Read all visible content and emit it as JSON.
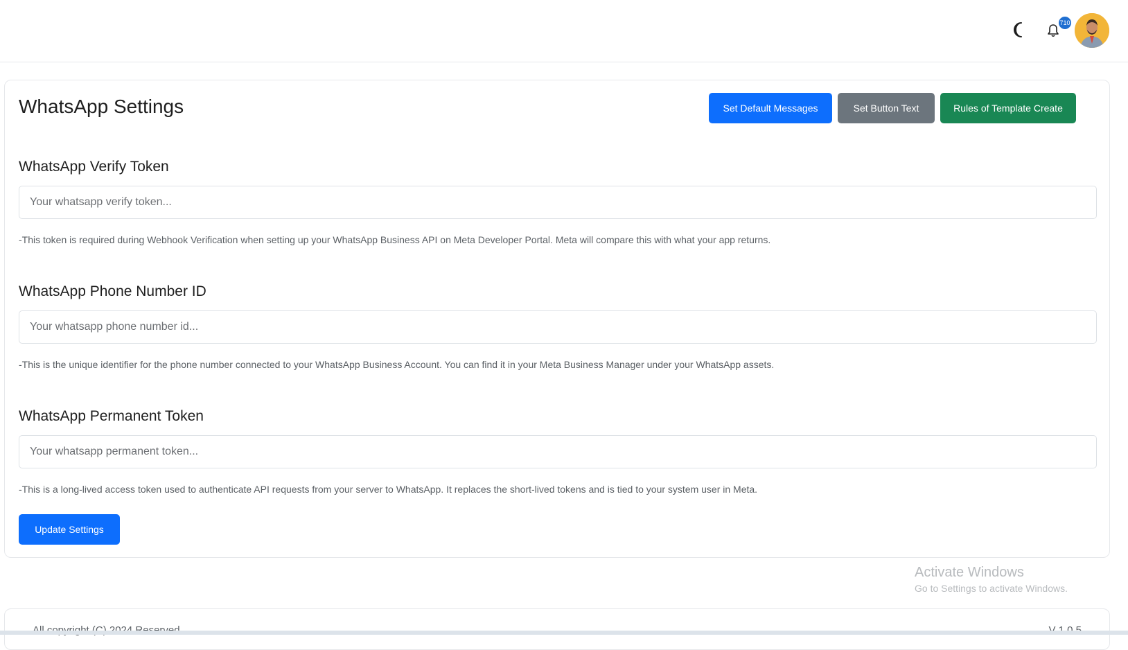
{
  "topbar": {
    "notifications_count": "710",
    "icons": {
      "theme": "moon-icon",
      "notifications": "bell-icon"
    },
    "avatar_bg": "#f2b538",
    "badge_color": "#1f6fd1"
  },
  "settings": {
    "title": "WhatsApp Settings",
    "buttons": {
      "default_messages": "Set Default Messages",
      "button_text": "Set Button Text",
      "template_rules": "Rules of Template Create"
    },
    "fields": [
      {
        "label": "WhatsApp Verify Token",
        "value": "",
        "placeholder": "Your whatsapp verify token...",
        "help": "-This token is required during Webhook Verification when setting up your WhatsApp Business API on Meta Developer Portal. Meta will compare this with what your app returns."
      },
      {
        "label": "WhatsApp Phone Number ID",
        "value": "",
        "placeholder": "Your whatsapp phone number id...",
        "help": "-This is the unique identifier for the phone number connected to your WhatsApp Business Account. You can find it in your Meta Business Manager under your WhatsApp assets."
      },
      {
        "label": "WhatsApp Permanent Token",
        "value": "",
        "placeholder": "Your whatsapp permanent token...",
        "help": "-This is a long-lived access token used to authenticate API requests from your server to WhatsApp. It replaces the short-lived tokens and is tied to your system user in Meta."
      }
    ],
    "submit_label": "Update Settings",
    "colors": {
      "primary": "#0d6efd",
      "secondary": "#6c757d",
      "success": "#198754"
    }
  },
  "watermark": {
    "title": "Activate Windows",
    "subtitle": "Go to Settings to activate Windows."
  },
  "footer": {
    "copyright": "All copyright (C) 2024 Reserved",
    "version": "V 1.0.5"
  }
}
